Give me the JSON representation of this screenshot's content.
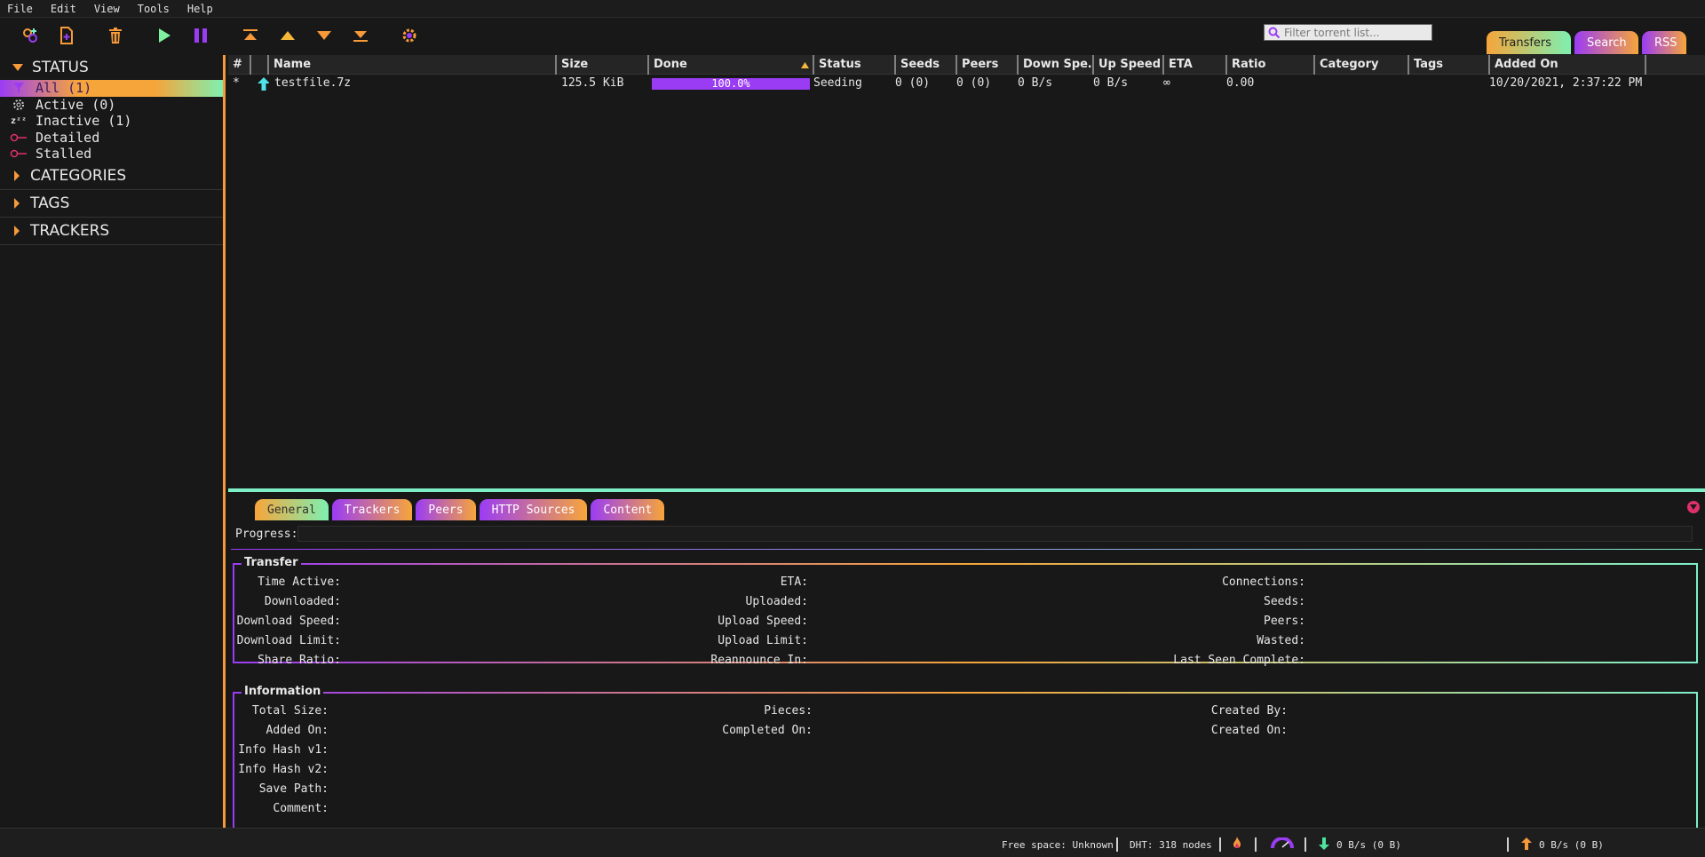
{
  "menu": [
    "File",
    "Edit",
    "View",
    "Tools",
    "Help"
  ],
  "toolbar": {
    "icons": [
      "add-torrent-link-icon",
      "add-torrent-file-icon",
      "delete-icon",
      "resume-icon",
      "pause-icon",
      "move-top-icon",
      "move-up-icon",
      "move-down-icon",
      "move-bottom-icon",
      "options-gear-icon"
    ],
    "search_placeholder": "Filter torrent list...",
    "tabs": [
      "Transfers",
      "Search",
      "RSS"
    ]
  },
  "sidebar": {
    "status_header": "STATUS",
    "status_items": [
      {
        "label": "All (1)",
        "icon": "filter-icon",
        "selected": true
      },
      {
        "label": "Active (0)",
        "icon": "active-gear-icon"
      },
      {
        "label": "Inactive (1)",
        "icon": "sleep-zzz-icon"
      },
      {
        "label": "Detailed",
        "icon": "detailed-icon"
      },
      {
        "label": "Stalled",
        "icon": "stalled-icon"
      }
    ],
    "categories_header": "CATEGORIES",
    "tags_header": "TAGS",
    "trackers_header": "TRACKERS"
  },
  "list": {
    "columns": [
      "#",
      "",
      "Name",
      "Size",
      "Done",
      "Status",
      "Seeds",
      "Peers",
      "Down Spe…",
      "Up Speed",
      "ETA",
      "Ratio",
      "Category",
      "Tags",
      "Added On"
    ],
    "rows": [
      {
        "num": "*",
        "name": "testfile.7z",
        "size": "125.5 KiB",
        "done": "100.0%",
        "done_fraction": 1.0,
        "status": "Seeding",
        "seeds": "0 (0)",
        "peers": "0 (0)",
        "down_speed": "0 B/s",
        "up_speed": "0 B/s",
        "eta": "∞",
        "ratio": "0.00",
        "category": "",
        "tags": "",
        "added_on": "10/20/2021, 2:37:22 PM"
      }
    ]
  },
  "props": {
    "tabs": [
      "General",
      "Trackers",
      "Peers",
      "HTTP Sources",
      "Content"
    ],
    "progress_label": "Progress:",
    "transfer_title": "Transfer",
    "transfer_col1": [
      "Time Active:",
      "Downloaded:",
      "Download Speed:",
      "Download Limit:",
      "Share Ratio:"
    ],
    "transfer_col2": [
      "ETA:",
      "Uploaded:",
      "Upload Speed:",
      "Upload Limit:",
      "Reannounce In:"
    ],
    "transfer_col3": [
      "Connections:",
      "Seeds:",
      "Peers:",
      "Wasted:",
      "Last Seen Complete:"
    ],
    "info_title": "Information",
    "info_col1": [
      "Total Size:",
      "Added On:",
      "Info Hash v1:",
      "Info Hash v2:",
      "Save Path:",
      "Comment:"
    ],
    "info_col2": [
      "Pieces:",
      "Completed On:"
    ],
    "info_col3": [
      "Created By:",
      "Created On:"
    ]
  },
  "statusbar": {
    "free_space": "Free space: Unknown",
    "dht": "DHT: 318 nodes",
    "download": "0 B/s (0 B)",
    "upload": "0 B/s (0 B)"
  },
  "colors": {
    "orange": "#f69a3a",
    "purple": "#9b3cf5",
    "mint": "#7ef0c8",
    "pink": "#e0306a"
  }
}
